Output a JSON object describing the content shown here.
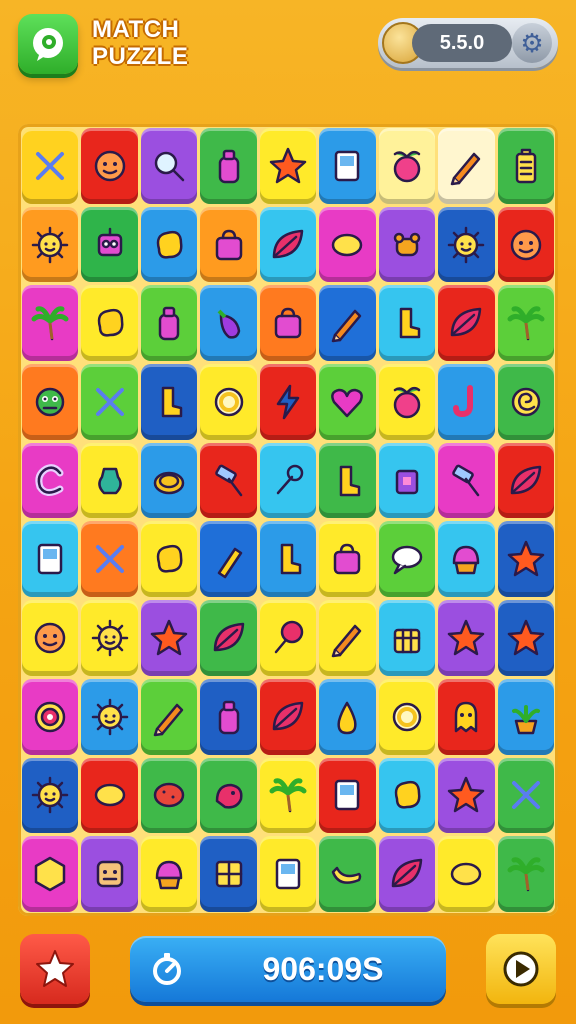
{
  "header": {
    "title_line1": "MATCH",
    "title_line2": "PUZZLE",
    "version": "5.5.0"
  },
  "footer": {
    "timer": "906:09S"
  },
  "colors": {
    "background": "#f5a514",
    "board": "#ffe07a",
    "star_button": "#e8392b",
    "timer_bar": "#1f8ee6",
    "play_button": "#f7c722",
    "logo_button": "#3dc83a"
  },
  "board": {
    "rows": [
      [
        {
          "c": "#ffd21f",
          "i": "crossed-tools"
        },
        {
          "c": "#e8261c",
          "i": "face"
        },
        {
          "c": "#9b4fe0",
          "i": "magnifier"
        },
        {
          "c": "#3fb949",
          "i": "bottle"
        },
        {
          "c": "#ffea2a",
          "i": "star"
        },
        {
          "c": "#2c9be8",
          "i": "card"
        },
        {
          "c": "#fff29a",
          "i": "apple"
        },
        {
          "c": "#fff6cf",
          "i": "pencil"
        },
        {
          "c": "#3fb949",
          "i": "battery"
        }
      ],
      [
        {
          "c": "#ff9b1f",
          "i": "sun-face"
        },
        {
          "c": "#2fb44a",
          "i": "robot"
        },
        {
          "c": "#2c9be8",
          "i": "blob"
        },
        {
          "c": "#ff9b1f",
          "i": "bag"
        },
        {
          "c": "#36c5ef",
          "i": "leaf"
        },
        {
          "c": "#e83bc5",
          "i": "lemon"
        },
        {
          "c": "#9b4fe0",
          "i": "bear"
        },
        {
          "c": "#1f5fc4",
          "i": "sun-face"
        },
        {
          "c": "#e8261c",
          "i": "face"
        }
      ],
      [
        {
          "c": "#e83bc5",
          "i": "palm"
        },
        {
          "c": "#ffea2a",
          "i": "blob"
        },
        {
          "c": "#5ccf3a",
          "i": "bottle"
        },
        {
          "c": "#2c9be8",
          "i": "eggplant"
        },
        {
          "c": "#ff7a1f",
          "i": "bag"
        },
        {
          "c": "#1f6fd8",
          "i": "pencil"
        },
        {
          "c": "#36c5ef",
          "i": "boot"
        },
        {
          "c": "#e8261c",
          "i": "leaf"
        },
        {
          "c": "#5ccf3a",
          "i": "palm"
        }
      ],
      [
        {
          "c": "#ff7a1f",
          "i": "monster"
        },
        {
          "c": "#5ccf3a",
          "i": "crossed-tools"
        },
        {
          "c": "#1f5fc4",
          "i": "boot"
        },
        {
          "c": "#ffea2a",
          "i": "ring"
        },
        {
          "c": "#e8261c",
          "i": "bolt"
        },
        {
          "c": "#5ccf3a",
          "i": "heart"
        },
        {
          "c": "#ffea2a",
          "i": "apple"
        },
        {
          "c": "#2c9be8",
          "i": "hook"
        },
        {
          "c": "#3fb949",
          "i": "swirl"
        }
      ],
      [
        {
          "c": "#e83bc5",
          "i": "letter-c"
        },
        {
          "c": "#ffea2a",
          "i": "vase"
        },
        {
          "c": "#2c9be8",
          "i": "coin"
        },
        {
          "c": "#e8261c",
          "i": "hammer"
        },
        {
          "c": "#36c5ef",
          "i": "wrench"
        },
        {
          "c": "#3fb949",
          "i": "boot"
        },
        {
          "c": "#36c5ef",
          "i": "cube"
        },
        {
          "c": "#e83bc5",
          "i": "hammer"
        },
        {
          "c": "#e8261c",
          "i": "leaf"
        }
      ],
      [
        {
          "c": "#36c5ef",
          "i": "card"
        },
        {
          "c": "#ff7a1f",
          "i": "crossed-tools"
        },
        {
          "c": "#ffea2a",
          "i": "blob"
        },
        {
          "c": "#1f6fd8",
          "i": "brush"
        },
        {
          "c": "#2c9be8",
          "i": "boot"
        },
        {
          "c": "#ffea2a",
          "i": "bag"
        },
        {
          "c": "#5ccf3a",
          "i": "bubble"
        },
        {
          "c": "#36c5ef",
          "i": "cupcake"
        },
        {
          "c": "#1f5fc4",
          "i": "star"
        }
      ],
      [
        {
          "c": "#ffea2a",
          "i": "face"
        },
        {
          "c": "#ffea2a",
          "i": "sun-face"
        },
        {
          "c": "#9b4fe0",
          "i": "star"
        },
        {
          "c": "#3fb949",
          "i": "leaf"
        },
        {
          "c": "#ffea2a",
          "i": "lollipop"
        },
        {
          "c": "#ffea2a",
          "i": "pencil"
        },
        {
          "c": "#36c5ef",
          "i": "basket"
        },
        {
          "c": "#9b4fe0",
          "i": "star"
        },
        {
          "c": "#1f5fc4",
          "i": "star"
        }
      ],
      [
        {
          "c": "#e83bc5",
          "i": "target"
        },
        {
          "c": "#2c9be8",
          "i": "sun-face"
        },
        {
          "c": "#5ccf3a",
          "i": "pencil"
        },
        {
          "c": "#1f5fc4",
          "i": "bottle"
        },
        {
          "c": "#e8261c",
          "i": "leaf"
        },
        {
          "c": "#2c9be8",
          "i": "pear"
        },
        {
          "c": "#ffea2a",
          "i": "ring"
        },
        {
          "c": "#e8261c",
          "i": "ghost"
        },
        {
          "c": "#2c9be8",
          "i": "plant"
        }
      ],
      [
        {
          "c": "#1f5fc4",
          "i": "sun-face"
        },
        {
          "c": "#e8261c",
          "i": "lemon"
        },
        {
          "c": "#3fb949",
          "i": "potato"
        },
        {
          "c": "#3fb949",
          "i": "bird"
        },
        {
          "c": "#ffea2a",
          "i": "palm"
        },
        {
          "c": "#e8261c",
          "i": "card"
        },
        {
          "c": "#36c5ef",
          "i": "blob"
        },
        {
          "c": "#9b4fe0",
          "i": "star"
        },
        {
          "c": "#3fb949",
          "i": "crossed-tools"
        }
      ],
      [
        {
          "c": "#e83bc5",
          "i": "hexagon"
        },
        {
          "c": "#9b4fe0",
          "i": "robot-face"
        },
        {
          "c": "#ffea2a",
          "i": "cupcake"
        },
        {
          "c": "#1f5fc4",
          "i": "window"
        },
        {
          "c": "#ffea2a",
          "i": "card"
        },
        {
          "c": "#3fb949",
          "i": "banana"
        },
        {
          "c": "#9b4fe0",
          "i": "leaf"
        },
        {
          "c": "#ffea2a",
          "i": "lemon"
        },
        {
          "c": "#3fb949",
          "i": "palm"
        }
      ]
    ]
  }
}
